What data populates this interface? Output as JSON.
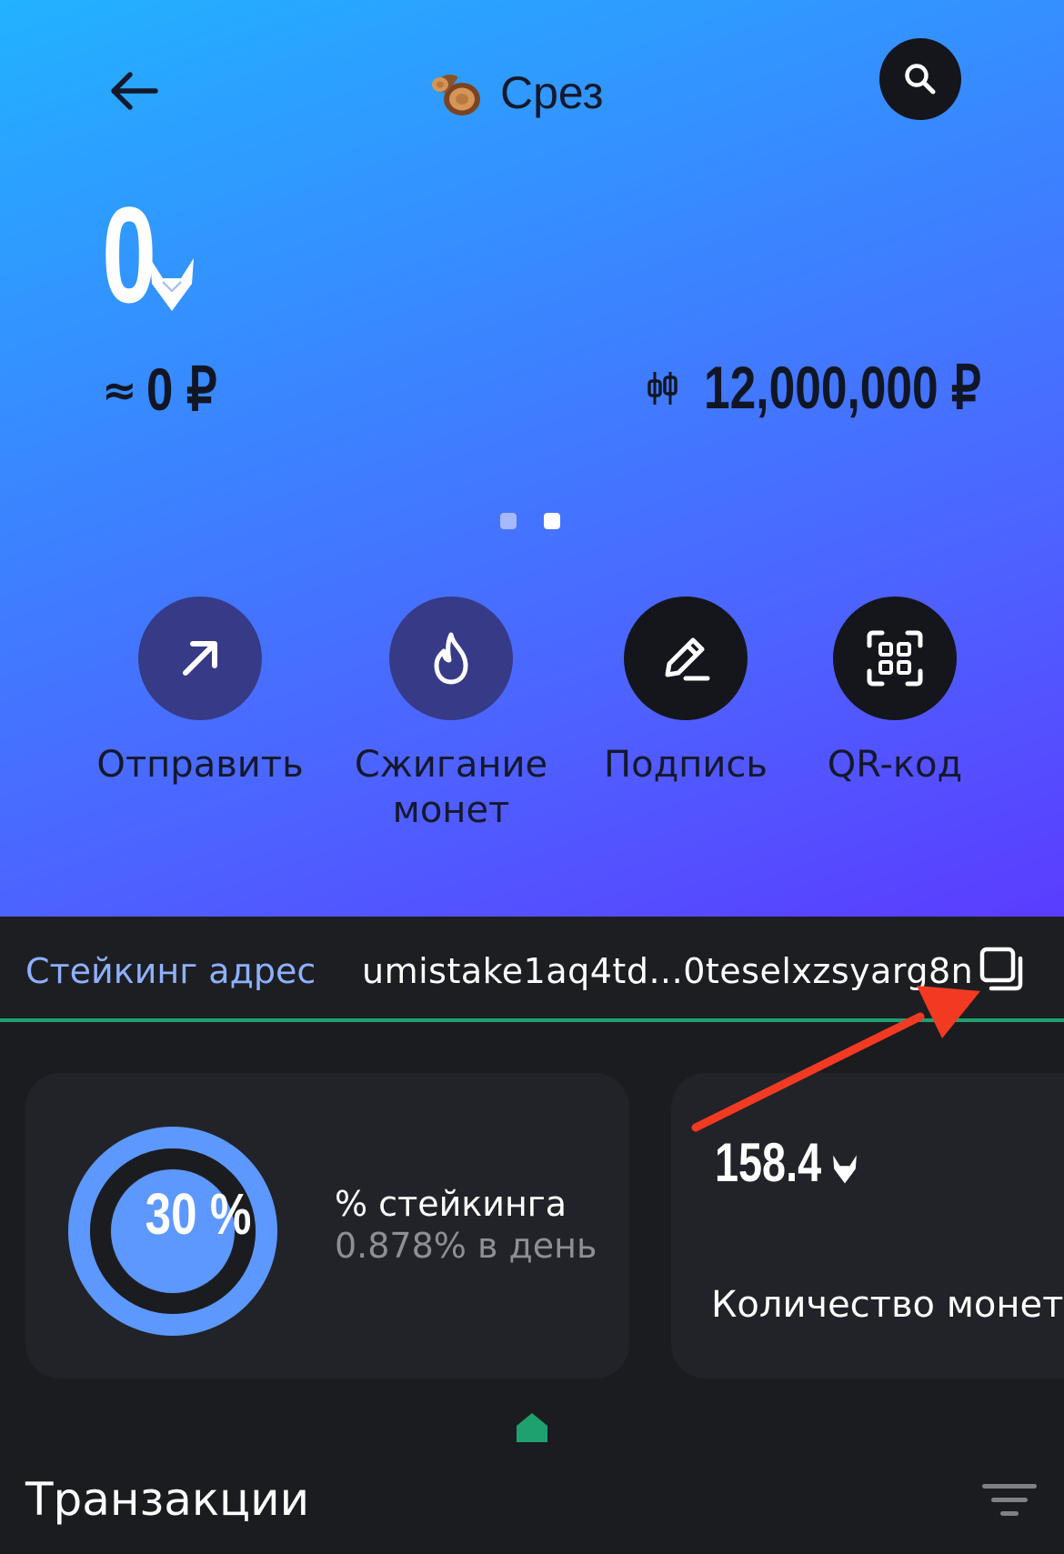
{
  "header": {
    "title": "Срез",
    "back_icon": "arrow-left-icon",
    "search_icon": "search-icon",
    "emoji_icon": "wood-log-icon"
  },
  "balance": {
    "amount": "0",
    "coin_icon": "fox-coin-icon",
    "approx_symbol": "≈",
    "rub_value": "0 ₽",
    "price_icon": "candlestick-icon",
    "price_value": "12,000,000 ₽"
  },
  "pager": {
    "count": 2,
    "active_index": 1
  },
  "actions": [
    {
      "label": "Отправить",
      "icon": "arrow-up-right-icon"
    },
    {
      "label": "Сжигание монет",
      "label_line1": "Сжигание",
      "label_line2": "монет",
      "icon": "flame-icon"
    },
    {
      "label": "Подпись",
      "icon": "pen-icon"
    },
    {
      "label": "QR-код",
      "icon": "qr-scan-icon"
    }
  ],
  "staking": {
    "label": "Стейкинг адрес",
    "address": "umistake1aq4td...0teselxzsyarg8n",
    "copy_icon": "copy-icon"
  },
  "cards": {
    "percent": {
      "ring_text": "30 %",
      "ring_fraction": 0.3,
      "title": "% стейкинга",
      "subtitle": "0.878% в день"
    },
    "coins": {
      "value": "158.4",
      "label": "Количество монет"
    }
  },
  "transactions": {
    "title": "Транзакции",
    "filter_icon": "filter-icon"
  },
  "colors": {
    "accent_green": "#1fa06f",
    "ring_blue": "#5c98ff",
    "link_blue": "#8eb0ff",
    "annotation_red": "#f23a22"
  }
}
